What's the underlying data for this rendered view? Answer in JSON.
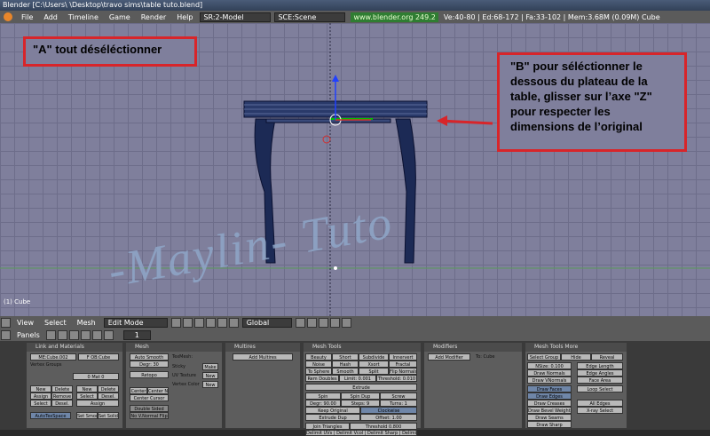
{
  "window": {
    "title": "Blender [C:\\Users\\          \\Desktop\\travo sims\\table tuto.blend]"
  },
  "menubar": {
    "items": [
      "File",
      "Add",
      "Timeline",
      "Game",
      "Render",
      "Help"
    ],
    "screen": "SR:2-Model",
    "scene": "SCE:Scene",
    "version": "www.blender.org 249.2",
    "stats": "Ve:40-80 | Ed:68-172 | Fa:33-102 | Mem:3.68M (0.09M) Cube"
  },
  "viewport": {
    "object_label": "(1) Cube",
    "callout_a": "\"A\" tout déséléctionner",
    "callout_b": "\"B\" pour séléctionner le dessous du plateau de la table, glisser sur l’axe \"Z\" pour respecter les dimensions de l’original",
    "watermark": "-Maylin- Tuto",
    "colors": {
      "callout_border": "#d8252a",
      "arrow": "#d8252a"
    }
  },
  "header3d": {
    "menus": [
      "View",
      "Select",
      "Mesh"
    ],
    "mode": "Edit Mode",
    "orientation": "Global"
  },
  "buttons_header": {
    "label": "Panels",
    "frame": "1"
  },
  "panels": {
    "link": {
      "title": "Link and Materials",
      "me": "ME:Cube.002",
      "ob": "F OB:Cube",
      "vertex_groups": "Vertex Groups",
      "mat": "0 Mat 0",
      "new": "New",
      "delete": "Delete",
      "assign": "Assign",
      "remove": "Remove",
      "select": "Select",
      "deselect": "Desel.",
      "autotexspace": "AutoTexSpace",
      "set_smooth": "Set Smooth",
      "set_solid": "Set Solid"
    },
    "mesh": {
      "title": "Mesh",
      "auto_smooth": "Auto Smooth",
      "degr": "Degr: 30",
      "retopo": "Retopo",
      "texmesh": "TexMesh:",
      "sticky": "Sticky",
      "uv_texture": "UV Texture",
      "vertex_color": "Vertex Color",
      "make": "Make",
      "new": "New",
      "center": "Center",
      "center_new": "Center New",
      "center_cursor": "Center Cursor",
      "double_sided": "Double Sided",
      "no_vnormal_flip": "No V.Normal Flip"
    },
    "multires": {
      "title": "Multires",
      "add": "Add Multires"
    },
    "mesh_tools": {
      "title": "Mesh Tools",
      "beauty": "Beauty",
      "short": "Short",
      "subdivide": "Subdivide",
      "innervert": "Innervert",
      "noise": "Noise",
      "hash": "Hash",
      "xsort": "Xsort",
      "fractal": "Fractal",
      "to_sphere": "To Sphere",
      "smooth": "Smooth",
      "split": "Split",
      "flip_normals": "Flip Normals",
      "rem_doubles": "Rem Doubles",
      "limit": "Limit: 0.001",
      "threshold": "Threshold: 0.010",
      "extrude": "Extrude",
      "screw": "Screw",
      "spin": "Spin",
      "spin_dup": "Spin Dup",
      "degr": "Degr: 90.00",
      "steps": "Steps: 9",
      "turns": "Turns: 1",
      "keep_original": "Keep Original",
      "clockwise": "Clockwise",
      "extrude_dup": "Extrude Dup",
      "offset": "Offset: 1.00",
      "join_triangles": "Join Triangles",
      "threshold2": "Threshold 0.800",
      "delimit": "Delimit UVs | Delimit Vcol | Delimit Sharp | Delimit Mat"
    },
    "modifiers": {
      "title": "Modifiers",
      "add": "Add Modifier",
      "to": "To: Cube"
    },
    "mesh_tools_more": {
      "title": "Mesh Tools More",
      "select_group": "Select Group",
      "hide": "Hide",
      "reveal": "Reveal",
      "nsize": "NSize: 0.100",
      "draw_normals": "Draw Normals",
      "draw_vnormals": "Draw VNormals",
      "edge_length": "Edge Length",
      "edge_angles": "Edge Angles",
      "face_area": "Face Area",
      "draw_faces": "Draw Faces",
      "draw_edges": "Draw Edges",
      "draw_creases": "Draw Creases",
      "draw_bevel": "Draw Bevel Weights",
      "draw_seams": "Draw Seams",
      "draw_sharp": "Draw Sharp",
      "loop_select": "Loop Select",
      "all_edges": "All Edges",
      "xray": "X-ray Select"
    }
  }
}
